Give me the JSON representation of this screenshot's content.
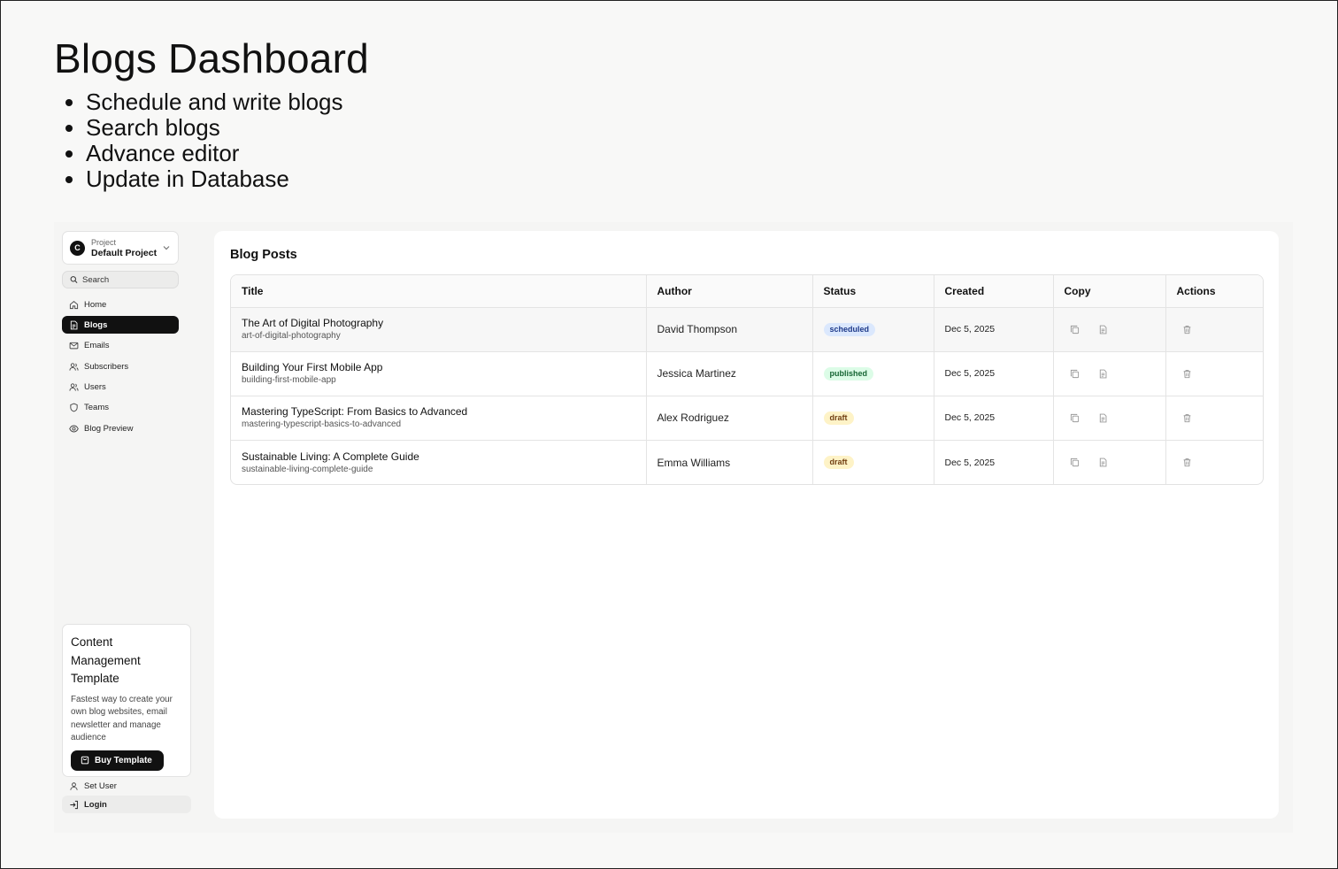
{
  "intro": {
    "title": "Blogs Dashboard",
    "bullets": [
      "Schedule and write blogs",
      "Search blogs",
      "Advance editor",
      "Update in Database"
    ]
  },
  "sidebar": {
    "project": {
      "avatar_letter": "C",
      "kicker": "Project",
      "name": "Default Project"
    },
    "search": {
      "placeholder": "Search"
    },
    "items": [
      {
        "label": "Home",
        "icon": "home-icon"
      },
      {
        "label": "Blogs",
        "icon": "file-text-icon",
        "active": true
      },
      {
        "label": "Emails",
        "icon": "mail-icon"
      },
      {
        "label": "Subscribers",
        "icon": "users-icon"
      },
      {
        "label": "Users",
        "icon": "users-icon"
      },
      {
        "label": "Teams",
        "icon": "shield-icon"
      },
      {
        "label": "Blog Preview",
        "icon": "eye-icon"
      }
    ],
    "promo": {
      "title": "Content Management Template",
      "description": "Fastest way to create your own blog websites, email newsletter and manage audience",
      "button_label": "Buy Template"
    },
    "footer": {
      "set_user": "Set User",
      "login": "Login"
    }
  },
  "main": {
    "title": "Blog Posts",
    "columns": [
      "Title",
      "Author",
      "Status",
      "Created",
      "Copy",
      "Actions"
    ],
    "rows": [
      {
        "title": "The Art of Digital Photography",
        "slug": "art-of-digital-photography",
        "author": "David Thompson",
        "status": "scheduled",
        "created": "Dec 5, 2025"
      },
      {
        "title": "Building Your First Mobile App",
        "slug": "building-first-mobile-app",
        "author": "Jessica Martinez",
        "status": "published",
        "created": "Dec 5, 2025"
      },
      {
        "title": "Mastering TypeScript: From Basics to Advanced",
        "slug": "mastering-typescript-basics-to-advanced",
        "author": "Alex Rodriguez",
        "status": "draft",
        "created": "Dec 5, 2025"
      },
      {
        "title": "Sustainable Living: A Complete Guide",
        "slug": "sustainable-living-complete-guide",
        "author": "Emma Williams",
        "status": "draft",
        "created": "Dec 5, 2025"
      }
    ]
  },
  "colors": {
    "accent": "#111111",
    "scheduled_bg": "#dbe8fd",
    "published_bg": "#dcfce7",
    "draft_bg": "#fef3c7"
  }
}
